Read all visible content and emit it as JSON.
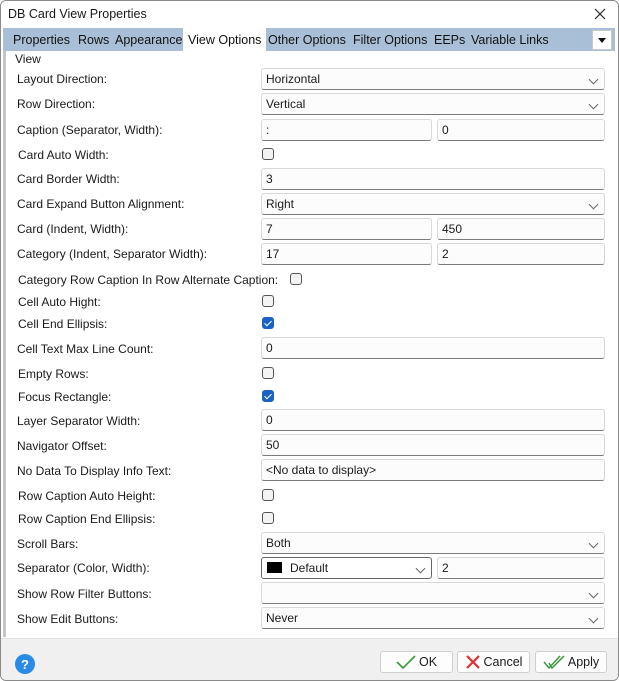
{
  "window": {
    "title": "DB Card View Properties"
  },
  "tabs": [
    {
      "label": "Properties",
      "active": false
    },
    {
      "label": "Rows",
      "active": false
    },
    {
      "label": "Appearance",
      "active": false
    },
    {
      "label": "View Options",
      "active": true
    },
    {
      "label": "Other Options",
      "active": false
    },
    {
      "label": "Filter Options",
      "active": false
    },
    {
      "label": "EEPs",
      "active": false
    },
    {
      "label": "Variable Links",
      "active": false
    }
  ],
  "group": {
    "label": "View"
  },
  "rows": {
    "layout_direction": {
      "label": "Layout Direction:",
      "value": "Horizontal"
    },
    "row_direction": {
      "label": "Row Direction:",
      "value": "Vertical"
    },
    "caption": {
      "label": "Caption (Separator, Width):",
      "separator": ":",
      "width": "0"
    },
    "card_auto_width": {
      "label": "Card Auto Width:",
      "checked": false
    },
    "card_border_width": {
      "label": "Card Border Width:",
      "value": "3"
    },
    "card_expand_button_alignment": {
      "label": "Card Expand Button Alignment:",
      "value": "Right"
    },
    "card": {
      "label": "Card (Indent, Width):",
      "indent": "7",
      "width": "450"
    },
    "category": {
      "label": "Category (Indent, Separator Width):",
      "indent": "17",
      "separator_width": "2"
    },
    "category_row_caption": {
      "label": "Category Row Caption In Row Alternate Caption:",
      "checked": false
    },
    "cell_auto_hight": {
      "label": "Cell Auto Hight:",
      "checked": false
    },
    "cell_end_ellipsis": {
      "label": "Cell End Ellipsis:",
      "checked": true
    },
    "cell_text_max_line_count": {
      "label": "Cell Text Max Line Count:",
      "value": "0"
    },
    "empty_rows": {
      "label": "Empty Rows:",
      "checked": false
    },
    "focus_rectangle": {
      "label": "Focus Rectangle:",
      "checked": true
    },
    "layer_separator_width": {
      "label": "Layer Separator Width:",
      "value": "0"
    },
    "navigator_offset": {
      "label": "Navigator Offset:",
      "value": "50"
    },
    "no_data_text": {
      "label": "No Data To Display Info Text:",
      "value": "<No data to display>"
    },
    "row_caption_auto_height": {
      "label": "Row Caption Auto Height:",
      "checked": false
    },
    "row_caption_end_ellipsis": {
      "label": "Row Caption End Ellipsis:",
      "checked": false
    },
    "scroll_bars": {
      "label": "Scroll Bars:",
      "value": "Both"
    },
    "separator": {
      "label": "Separator (Color, Width):",
      "color_name": "Default",
      "color_hex": "#000000",
      "width": "2"
    },
    "show_row_filter_buttons": {
      "label": "Show Row Filter Buttons:",
      "value": ""
    },
    "show_edit_buttons": {
      "label": "Show Edit Buttons:",
      "value": "Never"
    }
  },
  "footer": {
    "help_icon": "?",
    "ok_label": "OK",
    "cancel_label": "Cancel",
    "apply_label": "Apply"
  },
  "colors": {
    "tab_bar": "#a9bfd7",
    "checkbox_checked": "#1a63c4",
    "ok_check": "#3a9a3a",
    "cancel_x": "#e03030",
    "help": "#2a8be6"
  }
}
